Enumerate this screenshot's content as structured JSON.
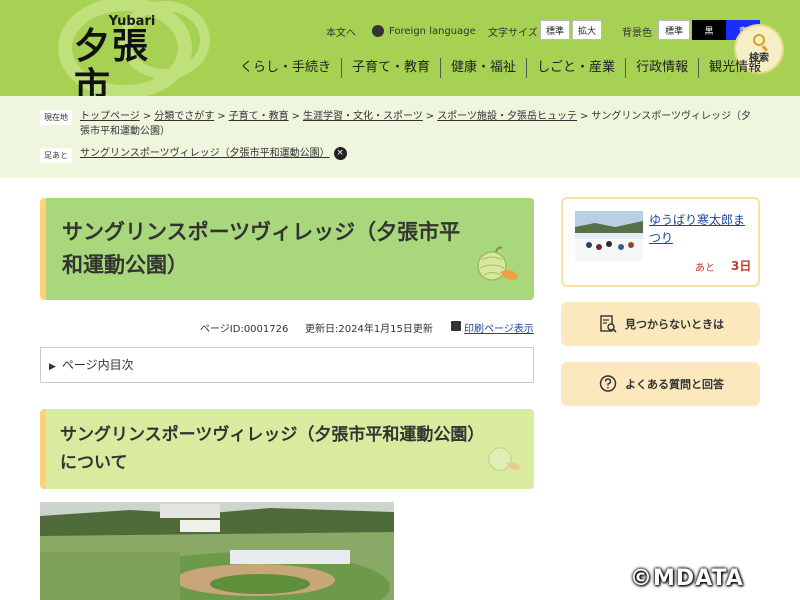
{
  "header": {
    "logo_small": "Yubari",
    "logo_big": "夕張市",
    "util_main": "本文へ",
    "util_foreign": "Foreign language",
    "font_size_label": "文字サイズ",
    "font_std": "標準",
    "font_big": "拡大",
    "bg_label": "背景色",
    "bg_std": "標準",
    "bg_black": "黒",
    "bg_blue": "青",
    "search_label": "検索",
    "nav": [
      "くらし・手続き",
      "子育て・教育",
      "健康・福祉",
      "しごと・産業",
      "行政情報",
      "観光情報"
    ]
  },
  "breadcrumb": {
    "current_label": "現在地",
    "items": [
      "トップページ",
      "分類でさがす",
      "子育て・教育",
      "生涯学習・文化・スポーツ",
      "スポーツ施設・夕張岳ヒュッテ"
    ],
    "current": "サングリンスポーツヴィレッジ（夕張市平和運動公園）",
    "footprint_label": "足あと",
    "footprint_item": "サングリンスポーツヴィレッジ（夕張市平和運動公園）",
    "close": "×"
  },
  "main": {
    "title": "サングリンスポーツヴィレッジ（夕張市平和運動公園）",
    "page_id": "ページID:0001726",
    "updated": "更新日:2024年1月15日更新",
    "print": "印刷ページ表示",
    "toc": "ページ内目次",
    "section_title": "サングリンスポーツヴィレッジ（夕張市平和運動公園）について"
  },
  "sidebar": {
    "event_title": "ゆうばり寒太郎まつり",
    "event_remain_label": "あと",
    "event_days": "3日",
    "btn_not_found": "見つからないときは",
    "btn_faq": "よくある質問と回答"
  },
  "watermark": "©MDATA",
  "colors": {
    "header_bg": "#a6d152",
    "crumb_bg": "#eef6de",
    "title_bg": "#a9d77c",
    "section_bg": "#d9eb9f",
    "accent": "#ffd27a",
    "link": "#1a46a0"
  }
}
